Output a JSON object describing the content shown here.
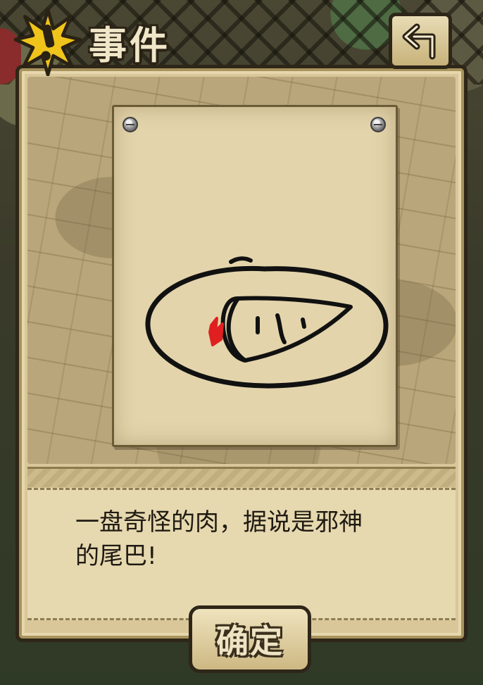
{
  "header": {
    "title": "事件",
    "title_icon": "exclamation-burst-icon",
    "back_icon": "back-arrow-icon"
  },
  "event": {
    "description_line1": "一盘奇怪的肉，据说是邪神",
    "description_line2": "的尾巴!"
  },
  "footer": {
    "confirm_label": "确定"
  },
  "colors": {
    "frame_border": "#2e2618",
    "parchment": "#e3d4ab",
    "panel": "#d9c79a",
    "sketch_stroke": "#111111",
    "sketch_mark": "#e02020",
    "burst_fill": "#f0c41a"
  }
}
